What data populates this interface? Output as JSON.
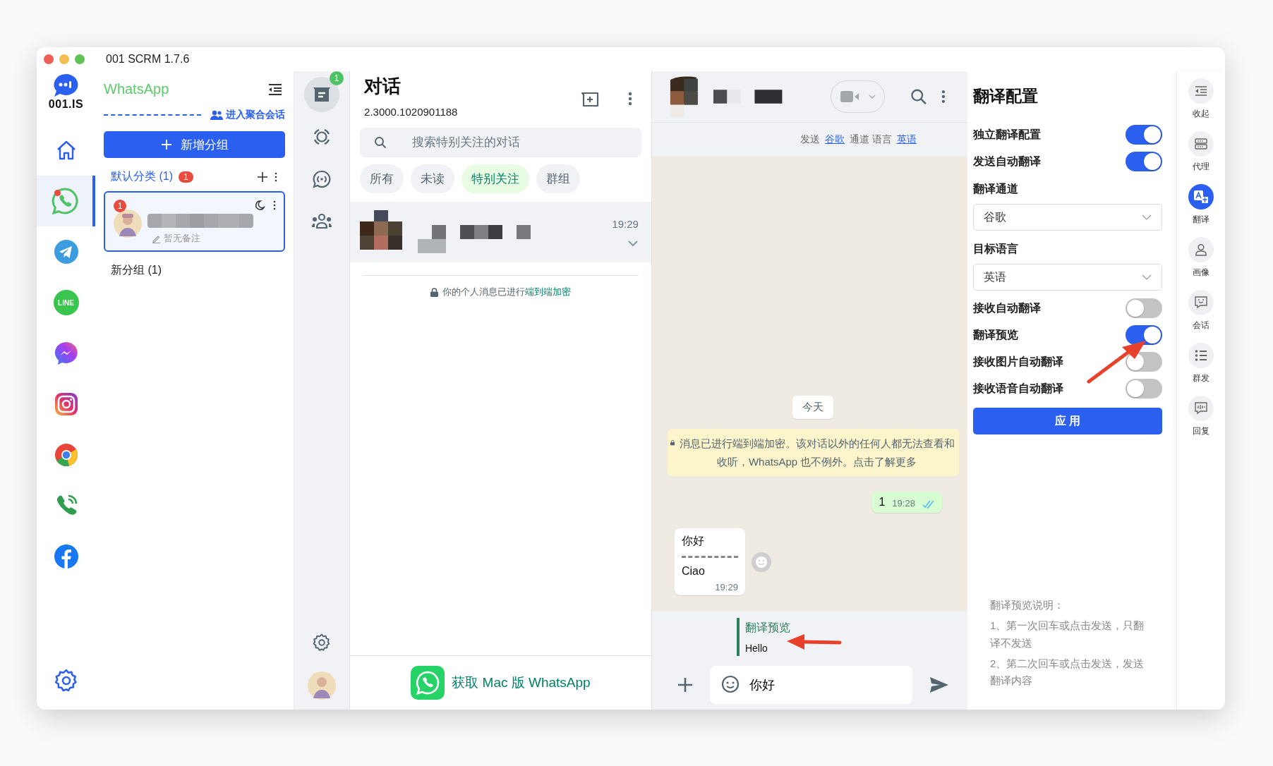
{
  "window": {
    "title": "001 SCRM 1.7.6"
  },
  "app_rail": {
    "logo_text": "001.IS",
    "items": [
      {
        "selected": false
      },
      {
        "selected": true,
        "unread": true
      },
      {
        "selected": false
      },
      {
        "selected": false,
        "label": "LINE"
      },
      {
        "selected": false
      },
      {
        "selected": false
      },
      {
        "selected": false
      },
      {
        "selected": false
      },
      {
        "selected": false
      }
    ]
  },
  "groups_panel": {
    "title": "WhatsApp",
    "aggregate_link": "进入聚合会话",
    "add_group_button": "新增分组",
    "groups": [
      {
        "name": "默认分类 (1)",
        "badge": "1",
        "selected": true,
        "contacts": [
          {
            "unread": "1",
            "note": "暂无备注",
            "selected": true
          }
        ]
      },
      {
        "name": "新分组 (1)",
        "selected": false
      }
    ]
  },
  "nav_rail": {
    "items": [
      {
        "selected": true,
        "badge": "1"
      },
      {
        "selected": false
      },
      {
        "selected": false
      },
      {
        "selected": false
      }
    ]
  },
  "chat_list": {
    "title": "对话",
    "version": "2.3000.1020901188",
    "search": {
      "placeholder": "搜索特别关注的对话"
    },
    "filters": [
      {
        "label": "所有",
        "selected": false
      },
      {
        "label": "未读",
        "selected": false
      },
      {
        "label": "特别关注",
        "selected": true
      },
      {
        "label": "群组",
        "selected": false
      }
    ],
    "chats": [
      {
        "time": "19:29",
        "selected": true
      }
    ],
    "encryption_note": "你的个人消息已进行",
    "encryption_link": "端到端加密",
    "get_app": "获取 Mac 版 WhatsApp"
  },
  "chat": {
    "translation_bar": {
      "send_label": "发送",
      "channel": "谷歌",
      "channel_label": "通道 语言",
      "language": "英语"
    },
    "messages": [
      {
        "kind": "date",
        "text": "今天"
      },
      {
        "kind": "system",
        "text": "消息已进行端到端加密。该对话以外的任何人都无法查看和收听，WhatsApp 也不例外。点击了解更多"
      },
      {
        "kind": "outgoing",
        "text": "1",
        "time": "19:28",
        "read": true
      },
      {
        "kind": "incoming",
        "text": "你好",
        "translation": "Ciao",
        "time": "19:29"
      }
    ],
    "preview": {
      "label": "翻译预览",
      "text": "Hello"
    },
    "input": {
      "value": "你好"
    }
  },
  "translation_settings": {
    "title": "翻译配置",
    "rows": [
      {
        "kind": "toggle",
        "label": "独立翻译配置",
        "on": true
      },
      {
        "kind": "toggle",
        "label": "发送自动翻译",
        "on": true
      },
      {
        "kind": "select",
        "label": "翻译通道",
        "value": "谷歌"
      },
      {
        "kind": "select",
        "label": "目标语言",
        "value": "英语"
      },
      {
        "kind": "toggle",
        "label": "接收自动翻译",
        "on": false
      },
      {
        "kind": "toggle",
        "label": "翻译预览",
        "on": true
      },
      {
        "kind": "toggle",
        "label": "接收图片自动翻译",
        "on": false
      },
      {
        "kind": "toggle",
        "label": "接收语音自动翻译",
        "on": false
      }
    ],
    "apply_button": "应 用",
    "notes": [
      "翻译预览说明：",
      "1、第一次回车或点击发送，只翻译不发送",
      "2、第二次回车或点击发送，发送翻译内容"
    ]
  },
  "side_tools": [
    {
      "label": "收起",
      "selected": false
    },
    {
      "label": "代理",
      "selected": false
    },
    {
      "label": "翻译",
      "selected": true
    },
    {
      "label": "画像",
      "selected": false
    },
    {
      "label": "会话",
      "selected": false
    },
    {
      "label": "群发",
      "selected": false
    },
    {
      "label": "回复",
      "selected": false
    }
  ]
}
